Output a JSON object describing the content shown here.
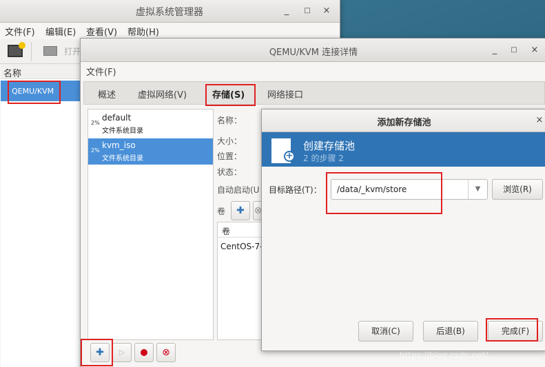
{
  "main_window": {
    "title": "虚拟系统管理器",
    "menu": [
      "文件(F)",
      "编辑(E)",
      "查看(V)",
      "帮助(H)"
    ],
    "toolbar_open_label": "打开",
    "name_header": "名称",
    "connection": "QEMU/KVM"
  },
  "details_window": {
    "title": "QEMU/KVM 连接详情",
    "menu_file": "文件(F)",
    "tabs": [
      "概述",
      "虚拟网络(V)",
      "存储(S)",
      "网络接口"
    ],
    "pools": [
      {
        "usage": "2%",
        "name": "default",
        "type": "文件系统目录"
      },
      {
        "usage": "2%",
        "name": "kvm_iso",
        "type": "文件系统目录"
      }
    ],
    "labels": {
      "name": "名称：",
      "size": "大小：",
      "location": "位置：",
      "state": "状态：",
      "autostart": "自动启动(U",
      "volumes": "卷"
    },
    "volume_header": "卷",
    "volume_item": "CentOS-7-"
  },
  "dialog": {
    "title": "添加新存储池",
    "banner_title": "创建存储池",
    "banner_step": "2 的步骤 2",
    "target_path_label": "目标路径(T)：",
    "target_path_value": "/data/_kvm/store",
    "browse": "浏览(R)",
    "cancel": "取消(C)",
    "back": "后退(B)",
    "finish": "完成(F)"
  },
  "watermark": "https://blog.csdn.net/..."
}
